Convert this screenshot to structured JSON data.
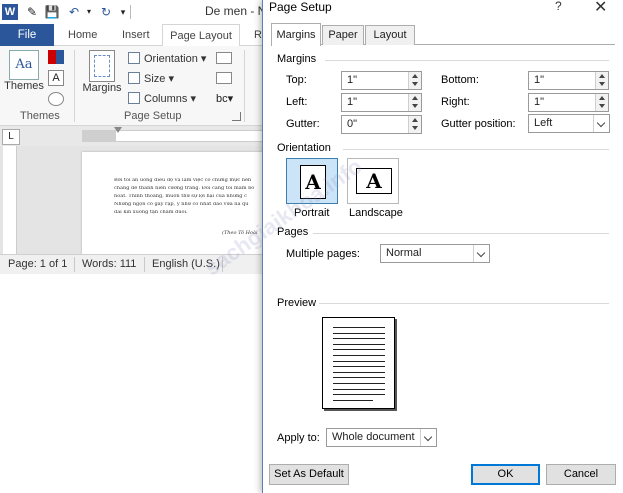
{
  "word": {
    "app_logo": "W",
    "window_title": "De men - N",
    "tabs": {
      "file": "File",
      "home": "Home",
      "insert": "Insert",
      "page_layout": "Page Layout",
      "partial": "R"
    },
    "ribbon": {
      "themes_label": "Themes",
      "themes_icon_text": "Aa",
      "margins_label": "Margins",
      "orientation_label": "Orientation",
      "size_label": "Size",
      "columns_label": "Columns",
      "group_themes": "Themes",
      "group_page_setup": "Page Setup"
    },
    "ruler_corner": "L",
    "document_lines": [
      "Bởi tôi ăn uống điều độ và làm việc có chừng mực nên",
      "chàng dế thanh niên cường tráng. Đôi càng tôi mẫm bó",
      "hoắt. Thỉnh thoảng, muốn thử sự lợi hại của những c",
      "Những ngọn cỏ gãy rạp, y như có nhát dao vừa lia qu",
      "dài kín xuống tận chấm đuôi."
    ],
    "document_signature": "(Theo Tô Hoài",
    "status": {
      "page": "Page: 1 of 1",
      "words": "Words: 111",
      "language": "English (U.S.)"
    }
  },
  "dialog": {
    "title": "Page Setup",
    "help_glyph": "?",
    "close_glyph": "✕",
    "tabs": [
      "Margins",
      "Paper",
      "Layout"
    ],
    "margins_heading": "Margins",
    "top_label": "Top:",
    "top_value": "1\"",
    "bottom_label": "Bottom:",
    "bottom_value": "1\"",
    "left_label": "Left:",
    "left_value": "1\"",
    "right_label": "Right:",
    "right_value": "1\"",
    "gutter_label": "Gutter:",
    "gutter_value": "0\"",
    "gutter_position_label": "Gutter position:",
    "gutter_position_value": "Left",
    "orientation_heading": "Orientation",
    "portrait_label": "Portrait",
    "landscape_label": "Landscape",
    "orientation_glyph": "A",
    "pages_heading": "Pages",
    "multiple_pages_label": "Multiple pages:",
    "multiple_pages_value": "Normal",
    "preview_heading": "Preview",
    "apply_to_label": "Apply to:",
    "apply_to_value": "Whole document",
    "set_default_button": "Set As Default",
    "ok_button": "OK",
    "cancel_button": "Cancel"
  },
  "watermark_text": "sachgiaikhoa.info",
  "colors": {
    "word_accent": "#2b579a",
    "ok_focus": "#0078d7",
    "portrait_selected_bg": "#cce4f7"
  }
}
